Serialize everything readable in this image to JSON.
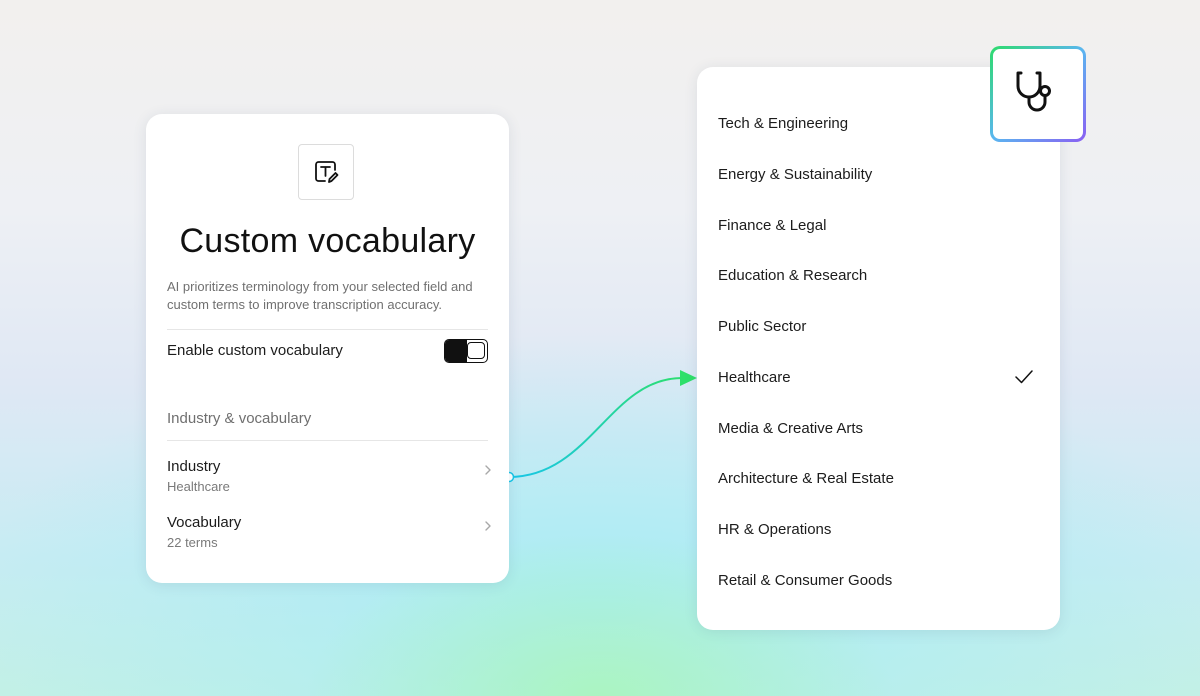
{
  "settings": {
    "app_icon": "text-edit-icon",
    "title": "Custom vocabulary",
    "description": "AI prioritizes terminology from your selected field and custom terms to improve transcription accuracy.",
    "toggle_label": "Enable custom vocabulary",
    "toggle_on": true,
    "section_header": "Industry & vocabulary",
    "rows": [
      {
        "label": "Industry",
        "value": "Healthcare"
      },
      {
        "label": "Vocabulary",
        "value": "22 terms"
      }
    ]
  },
  "industry_list": {
    "badge_icon": "stethoscope-icon",
    "selected": "Healthcare",
    "items": [
      "Tech & Engineering",
      "Energy & Sustainability",
      "Finance & Legal",
      "Education & Research",
      "Public Sector",
      "Healthcare",
      "Media & Creative Arts",
      "Architecture & Real Estate",
      "HR & Operations",
      "Retail & Consumer Goods"
    ]
  },
  "colors": {
    "connector_start": "#18c6e8",
    "connector_end": "#2ee06a",
    "badge_gradient": [
      "#2ddc6b",
      "#5ab6f0",
      "#8a5ef2"
    ]
  }
}
